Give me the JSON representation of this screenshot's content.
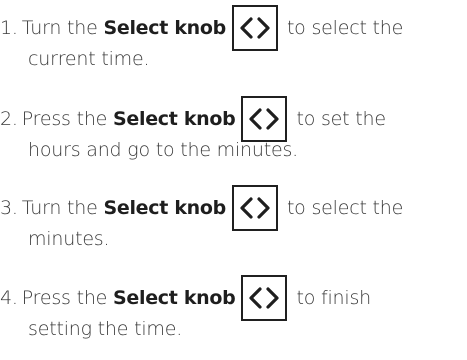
{
  "steps": [
    {
      "number": "1.",
      "verb": "Turn the",
      "control": "Select knob",
      "rest": "to select the",
      "continuation": "current time."
    },
    {
      "number": "2.",
      "verb": "Press the",
      "control": "Select knob",
      "rest": "to set the",
      "continuation": "hours and go to the minutes."
    },
    {
      "number": "3.",
      "verb": "Turn the",
      "control": "Select knob",
      "rest": "to select the",
      "continuation": "minutes."
    },
    {
      "number": "4.",
      "verb": "Press the",
      "control": "Select knob",
      "rest": "to finish",
      "continuation": "setting the time."
    }
  ],
  "icons": {
    "knob": "select-knob-icon"
  },
  "colors": {
    "text": "#3a3a3a",
    "emphasis": "#1e1e1e",
    "icon_border": "#202020"
  }
}
